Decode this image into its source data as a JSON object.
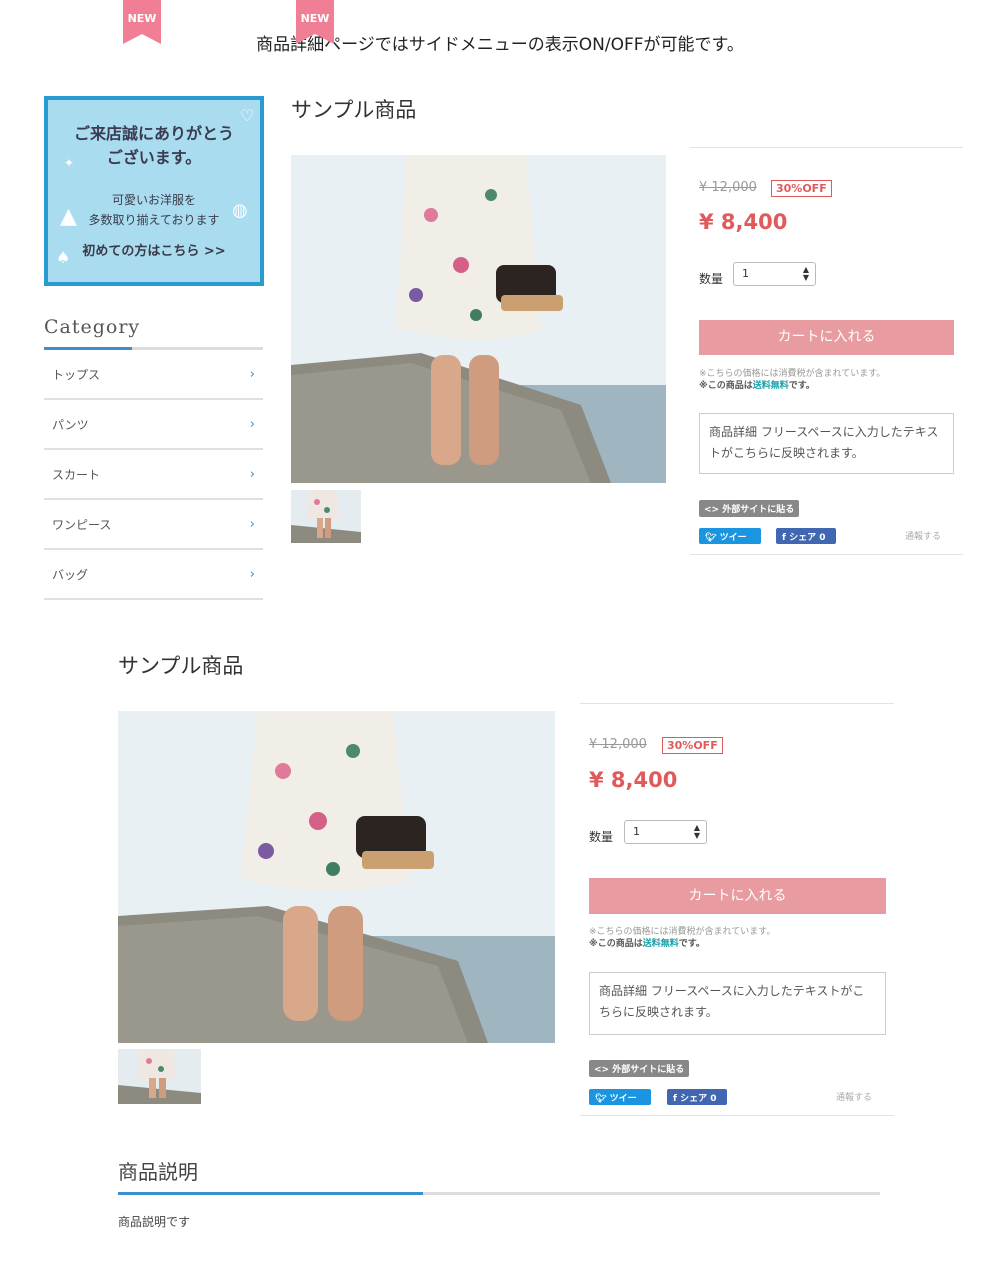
{
  "caption": "商品詳細ページではサイドメニューの表示ON/OFFが可能です。",
  "banner": {
    "title": "ご来店誠にありがとう\nございます。",
    "subtitle": "可愛いお洋服を\n多数取り揃えております",
    "link": "初めての方はこちら >>"
  },
  "category": {
    "title": "Category",
    "items": [
      {
        "label": "トップス"
      },
      {
        "label": "パンツ"
      },
      {
        "label": "スカート"
      },
      {
        "label": "ワンピース"
      },
      {
        "label": "バッグ"
      }
    ],
    "chevron": "›"
  },
  "product": {
    "title": "サンプル商品",
    "badge": "NEW",
    "old_price": "¥ 12,000",
    "discount": "30%OFF",
    "price": "¥ 8,400",
    "qty_label": "数量",
    "qty_value": "1",
    "cart_button": "カートに入れる",
    "tax_note": "※こちらの価格には消費税が含まれています。",
    "shipping_prefix": "※この商品は",
    "shipping_free": "送料無料",
    "shipping_suffix": "です。",
    "free_text": "商品詳細 フリースペースに入力したテキストがこちらに反映されます。",
    "embed_button": "<> 外部サイトに貼る",
    "tweet_button": "ツイート",
    "share_button": "シェア 0",
    "report_link": "通報する"
  },
  "description": {
    "title": "商品説明",
    "text": "商品説明です"
  },
  "icons": {
    "twitter": "twitter-bird-icon",
    "facebook": "facebook-f-icon",
    "select": "updown-arrows-icon"
  },
  "colors": {
    "accent_blue": "#3a8fcf",
    "price_red": "#e05a5a",
    "cart_pink": "#e89ba0",
    "ribbon_pink": "#f07e94",
    "banner_bg": "#a9dcef",
    "banner_border": "#2a9bd0"
  }
}
